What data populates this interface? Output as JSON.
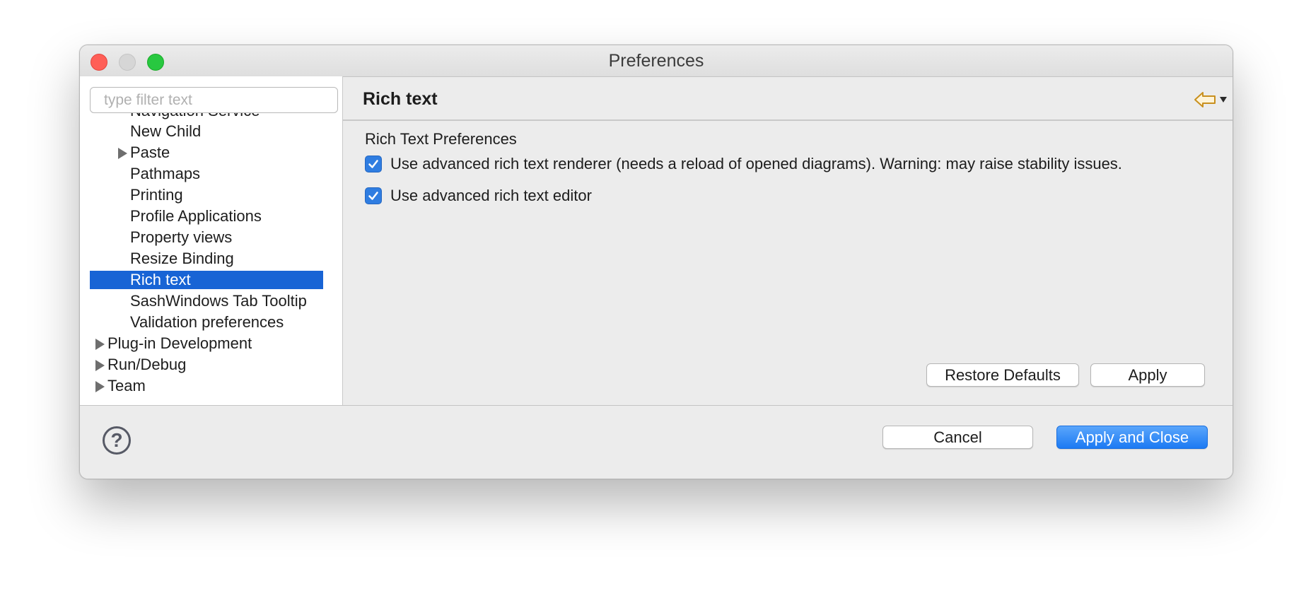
{
  "window": {
    "title": "Preferences"
  },
  "filter": {
    "placeholder": "type filter text"
  },
  "tree": {
    "items": [
      {
        "label": "Navigation Service"
      },
      {
        "label": "New Child"
      },
      {
        "label": "Paste",
        "expandable": true
      },
      {
        "label": "Pathmaps"
      },
      {
        "label": "Printing"
      },
      {
        "label": "Profile Applications"
      },
      {
        "label": "Property views"
      },
      {
        "label": "Resize Binding"
      },
      {
        "label": "Rich text",
        "selected": true
      },
      {
        "label": "SashWindows Tab Tooltip"
      },
      {
        "label": "Validation preferences"
      },
      {
        "label": "Plug-in Development",
        "expandable": true
      },
      {
        "label": "Run/Debug",
        "expandable": true
      },
      {
        "label": "Team",
        "expandable": true
      }
    ]
  },
  "page": {
    "title": "Rich text",
    "section_title": "Rich Text Preferences",
    "options": [
      {
        "label": "Use advanced rich text renderer (needs a reload of opened diagrams). Warning: may raise stability issues.",
        "checked": true
      },
      {
        "label": "Use advanced rich text editor",
        "checked": true
      }
    ],
    "nav": {
      "back_icon": "back-arrow-icon",
      "forward_icon": "forward-arrow-icon",
      "menu_icon": "view-menu-icon"
    },
    "restore_defaults_label": "Restore Defaults",
    "apply_label": "Apply"
  },
  "footer": {
    "help_icon": "?",
    "cancel_label": "Cancel",
    "apply_close_label": "Apply and Close"
  },
  "colors": {
    "selection": "#1864d5",
    "primary_button": "#1c7af3",
    "back_arrow": "#c9901e",
    "checkbox": "#2f7de1"
  }
}
